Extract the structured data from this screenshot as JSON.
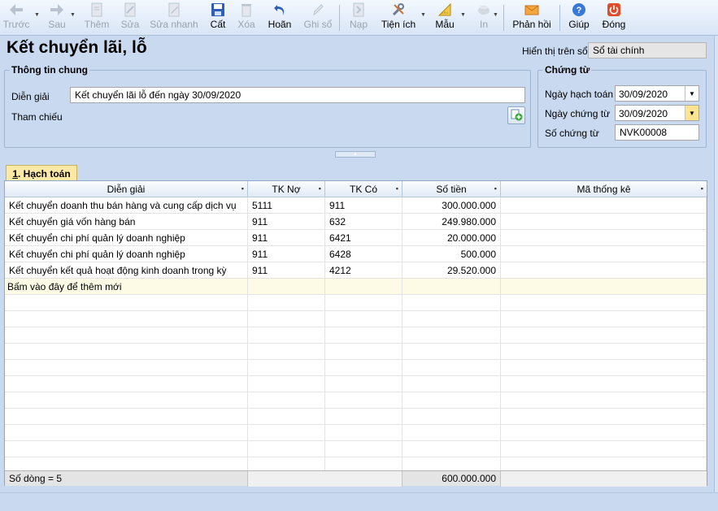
{
  "toolbar": {
    "buttons": [
      {
        "id": "prev",
        "label": "Trước",
        "icon": "arrow-left-icon",
        "enabled": false
      },
      {
        "id": "next",
        "label": "Sau",
        "icon": "arrow-right-icon",
        "enabled": false
      },
      {
        "id": "add",
        "label": "Thêm",
        "icon": "add-document-icon",
        "enabled": false
      },
      {
        "id": "edit",
        "label": "Sửa",
        "icon": "edit-document-icon",
        "enabled": false
      },
      {
        "id": "quick_edit",
        "label": "Sửa nhanh",
        "icon": "quick-edit-icon",
        "enabled": false
      },
      {
        "id": "save",
        "label": "Cất",
        "icon": "floppy-disk-icon",
        "enabled": true
      },
      {
        "id": "delete",
        "label": "Xóa",
        "icon": "delete-icon",
        "enabled": false
      },
      {
        "id": "undo",
        "label": "Hoãn",
        "icon": "undo-icon",
        "enabled": true
      },
      {
        "id": "post",
        "label": "Ghi sổ",
        "icon": "pencil-icon",
        "enabled": false
      },
      {
        "id": "load",
        "label": "Nạp",
        "icon": "load-icon",
        "enabled": false
      },
      {
        "id": "utilities",
        "label": "Tiện ích",
        "icon": "tools-icon",
        "enabled": true
      },
      {
        "id": "template",
        "label": "Mẫu",
        "icon": "template-icon",
        "enabled": true
      },
      {
        "id": "print",
        "label": "In",
        "icon": "printer-icon",
        "enabled": false
      },
      {
        "id": "feedback",
        "label": "Phản hồi",
        "icon": "envelope-icon",
        "enabled": true
      },
      {
        "id": "help",
        "label": "Giúp",
        "icon": "help-icon",
        "enabled": true
      },
      {
        "id": "close",
        "label": "Đóng",
        "icon": "power-icon",
        "enabled": true
      }
    ]
  },
  "header": {
    "title": "Kết chuyển lãi, lỗ",
    "display_label": "Hiển thị trên sổ",
    "display_value": "Sổ tài chính"
  },
  "general": {
    "title": "Thông tin chung",
    "description_label": "Diễn giải",
    "description_value": "Kết chuyển lãi lỗ đến ngày 30/09/2020",
    "reference_label": "Tham chiếu"
  },
  "voucher": {
    "title": "Chứng từ",
    "posting_date_label": "Ngày hạch toán",
    "posting_date_value": "30/09/2020",
    "voucher_date_label": "Ngày chứng từ",
    "voucher_date_value": "30/09/2020",
    "voucher_no_label": "Số chứng từ",
    "voucher_no_value": "NVK00008"
  },
  "tabs": {
    "accounting_num": "1",
    "accounting_label": ". Hạch toán"
  },
  "grid": {
    "columns": {
      "description": "Diễn giải",
      "debit": "TK Nợ",
      "credit": "TK Có",
      "amount": "Số tiền",
      "stat_code": "Mã thống kê"
    },
    "rows": [
      {
        "description": "Kết chuyển doanh thu bán hàng và cung cấp dịch vụ",
        "debit": "5111",
        "credit": "911",
        "amount": "300.000.000",
        "stat_code": ""
      },
      {
        "description": "Kết chuyển giá vốn hàng bán",
        "debit": "911",
        "credit": "632",
        "amount": "249.980.000",
        "stat_code": ""
      },
      {
        "description": "Kết chuyển chi phí quản lý doanh nghiệp",
        "debit": "911",
        "credit": "6421",
        "amount": "20.000.000",
        "stat_code": ""
      },
      {
        "description": "Kết chuyển chi phí quản lý doanh nghiệp",
        "debit": "911",
        "credit": "6428",
        "amount": "500.000",
        "stat_code": ""
      },
      {
        "description": "Kết chuyển kết quả hoạt động kinh doanh trong kỳ",
        "debit": "911",
        "credit": "4212",
        "amount": "29.520.000",
        "stat_code": ""
      }
    ],
    "new_row_hint": "Bấm vào đây để thêm mới",
    "footer": {
      "row_count": "Số dòng = 5",
      "total_amount": "600.000.000"
    }
  }
}
